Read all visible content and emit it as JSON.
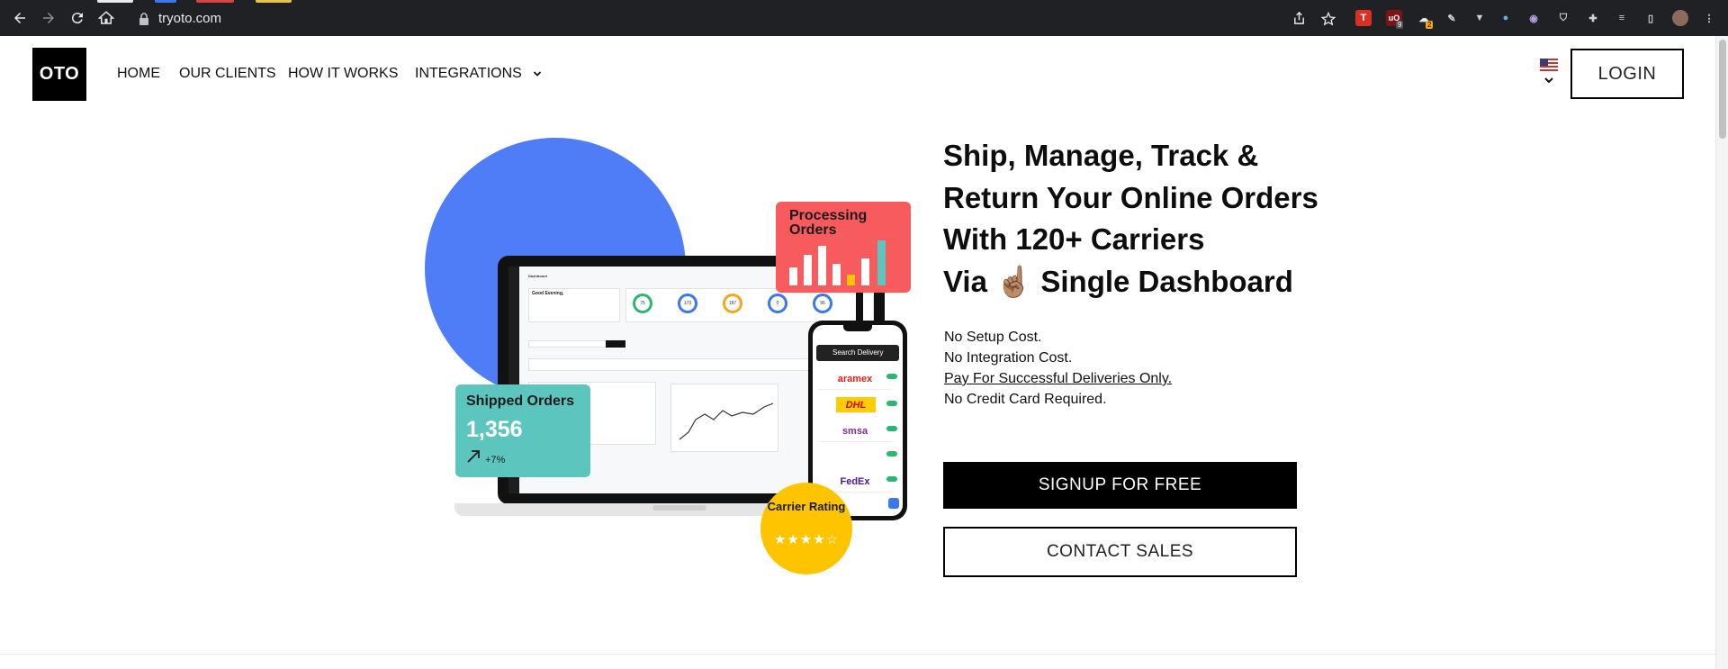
{
  "browser": {
    "url": "tryoto.com",
    "ext_badges": {
      "ublock": "9",
      "grammarly": "2"
    }
  },
  "header": {
    "logo": "OTO",
    "nav": [
      "HOME",
      "OUR CLIENTS",
      "HOW IT WORKS",
      "INTEGRATIONS"
    ],
    "login": "LOGIN"
  },
  "illustration": {
    "processing_label": "Processing Orders",
    "shipped_label": "Shipped Orders",
    "shipped_count": "1,356",
    "shipped_change": "+7%",
    "rating_label": "Carrier Rating",
    "rating_stars": 4,
    "phone_search": "Search Delivery",
    "carriers": [
      "aramex",
      "DHL",
      "smsa",
      "FedEx"
    ],
    "dashboard_greeting": "Good Evening,",
    "dashboard_title": "Dashboard",
    "stats": [
      "75",
      "173",
      "187",
      "0",
      "96"
    ]
  },
  "hero": {
    "headline_1": "Ship, Manage, Track &",
    "headline_2": "Return Your Online Orders",
    "headline_3": "With 120+ Carriers",
    "headline_4": "Via ☝🏽 Single Dashboard",
    "bullet_1": "No Setup Cost.",
    "bullet_2": "No Integration Cost.",
    "bullet_3": "Pay For Successful Deliveries Only.",
    "bullet_4": "No Credit Card Required.",
    "signup": "SIGNUP FOR FREE",
    "contact": "CONTACT SALES"
  },
  "colors": {
    "blue": "#4f7cf7",
    "red": "#f75b5e",
    "teal": "#5cc6be",
    "yellow": "#ffc400"
  }
}
